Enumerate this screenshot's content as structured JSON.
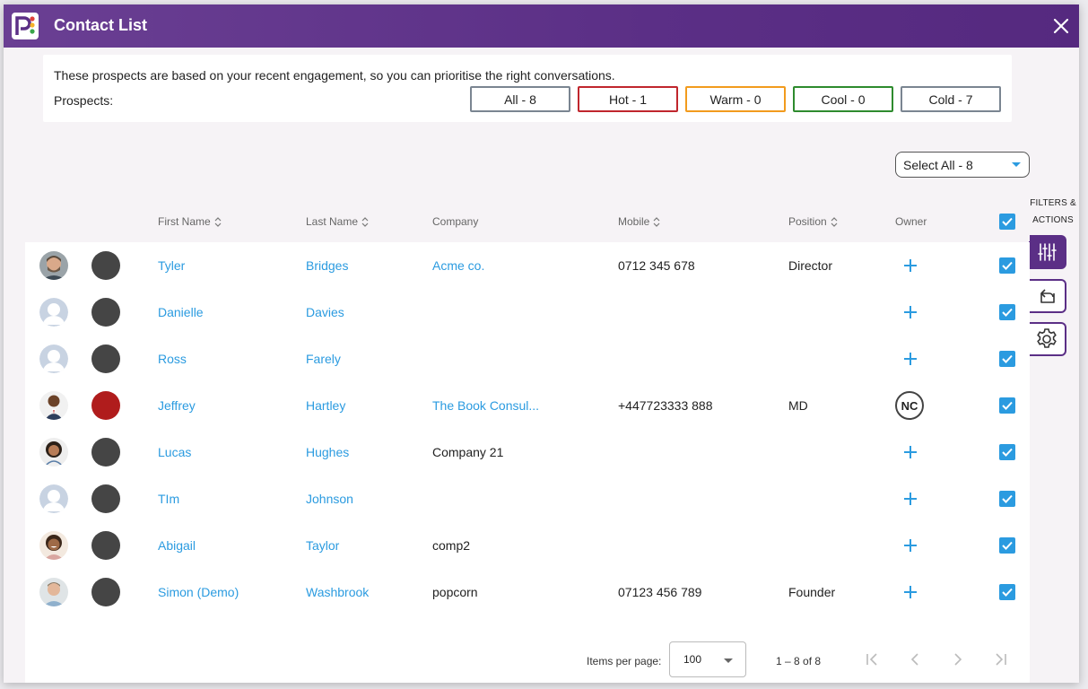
{
  "window": {
    "title": "Contact List"
  },
  "info": {
    "text": "These prospects are based on your recent engagement, so you can prioritise the right conversations.",
    "prospects_label": "Prospects:",
    "filters": [
      {
        "label": "All - 8",
        "color": "#7a8591"
      },
      {
        "label": "Hot - 1",
        "color": "#c0262d"
      },
      {
        "label": "Warm - 0",
        "color": "#f29b1d"
      },
      {
        "label": "Cool - 0",
        "color": "#2e8b2e"
      },
      {
        "label": "Cold - 7",
        "color": "#7a8591"
      }
    ]
  },
  "select_all": {
    "label": "Select All - 8"
  },
  "side_panel": {
    "label": "FILTERS & ACTIONS",
    "buttons": [
      "filters-icon",
      "export-icon",
      "settings-icon"
    ]
  },
  "table": {
    "headers": {
      "first_name": "First Name",
      "last_name": "Last Name",
      "company": "Company",
      "mobile": "Mobile",
      "position": "Position",
      "owner": "Owner"
    },
    "rows": [
      {
        "first": "Tyler",
        "last": "Bridges",
        "company": "Acme co.",
        "company_link": true,
        "mobile": "0712 345 678",
        "position": "Director",
        "owner": "",
        "status": "#454545",
        "avatar": "photo-man-beard"
      },
      {
        "first": "Danielle",
        "last": "Davies",
        "company": "",
        "company_link": false,
        "mobile": "",
        "position": "",
        "owner": "",
        "status": "#454545",
        "avatar": "placeholder"
      },
      {
        "first": "Ross",
        "last": "Farely",
        "company": "",
        "company_link": false,
        "mobile": "",
        "position": "",
        "owner": "",
        "status": "#454545",
        "avatar": "placeholder"
      },
      {
        "first": "Jeffrey",
        "last": "Hartley",
        "company": "The Book Consul...",
        "company_link": true,
        "mobile": "+447723333 888",
        "position": "MD",
        "owner": "NC",
        "status": "#b01c1c",
        "avatar": "photo-man-suit"
      },
      {
        "first": "Lucas",
        "last": "Hughes",
        "company": "Company 21",
        "company_link": false,
        "mobile": "",
        "position": "",
        "owner": "",
        "status": "#454545",
        "avatar": "photo-woman-curly"
      },
      {
        "first": "TIm",
        "last": "Johnson",
        "company": "",
        "company_link": false,
        "mobile": "",
        "position": "",
        "owner": "",
        "status": "#454545",
        "avatar": "placeholder"
      },
      {
        "first": "Abigail",
        "last": "Taylor",
        "company": "comp2",
        "company_link": false,
        "mobile": "",
        "position": "",
        "owner": "",
        "status": "#454545",
        "avatar": "photo-woman-smile"
      },
      {
        "first": "Simon (Demo)",
        "last": "Washbrook",
        "company": "popcorn",
        "company_link": false,
        "mobile": "07123 456 789",
        "position": "Founder",
        "owner": "",
        "status": "#454545",
        "avatar": "photo-man-grey"
      }
    ]
  },
  "paginator": {
    "items_per_page_label": "Items per page:",
    "items_per_page_value": "100",
    "range": "1 – 8 of 8"
  },
  "colors": {
    "header_purple": "#5b2f86",
    "accent_blue": "#2b9be0",
    "hot_red": "#b01c1c",
    "status_dark": "#454545"
  }
}
